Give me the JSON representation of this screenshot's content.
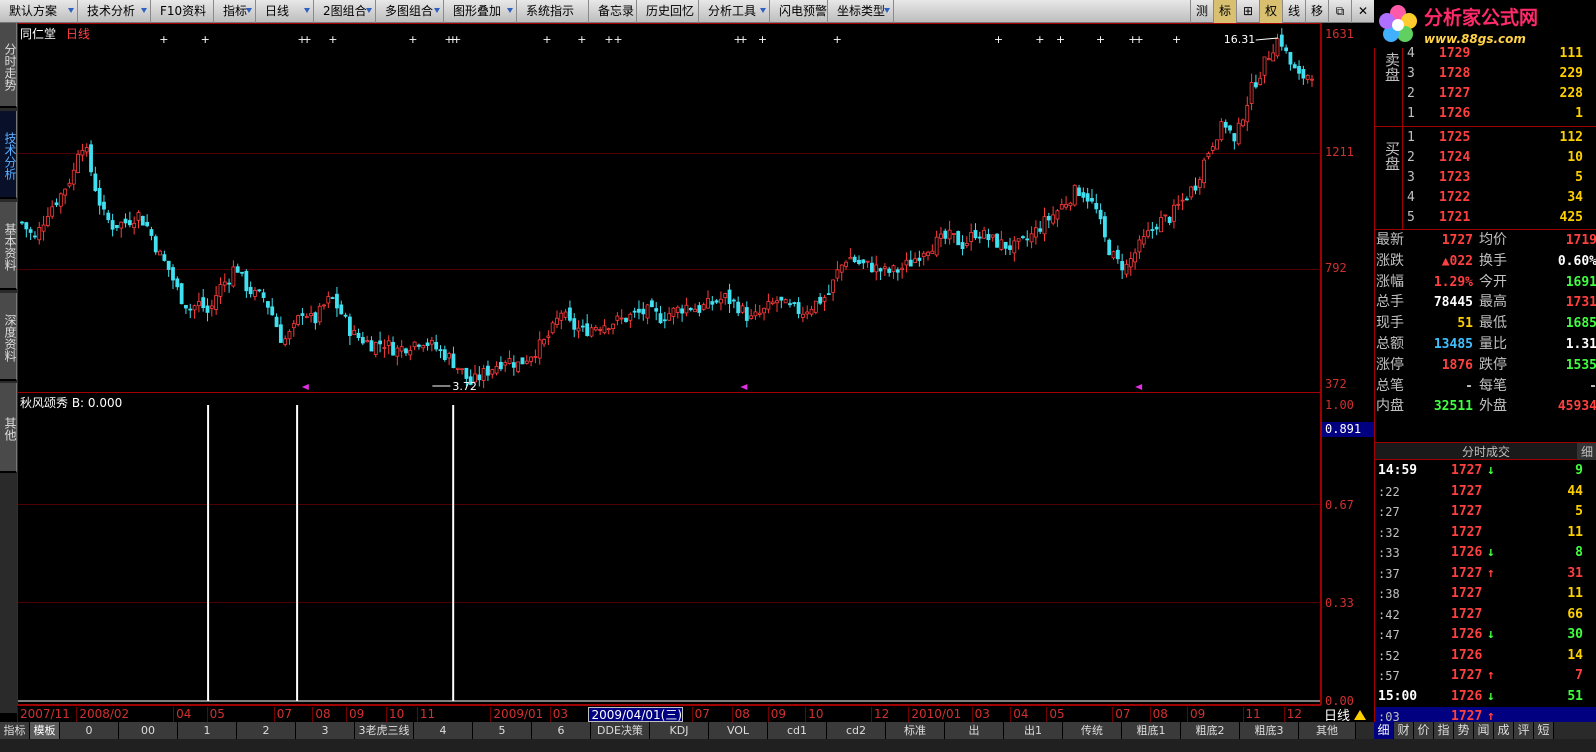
{
  "menu": [
    {
      "label": "默认方案",
      "arrow": true
    },
    {
      "label": "技术分析",
      "arrow": true
    },
    {
      "label": "F10资料",
      "arrow": false
    },
    {
      "label": "指标",
      "arrow": true
    },
    {
      "label": "日线",
      "arrow": true
    },
    {
      "label": "2图组合",
      "arrow": true
    },
    {
      "label": "多图组合",
      "arrow": true
    },
    {
      "label": "图形叠加",
      "arrow": true
    },
    {
      "label": "系统指示",
      "arrow": false
    },
    {
      "label": "备忘录",
      "arrow": false
    },
    {
      "label": "历史回忆",
      "arrow": false
    },
    {
      "label": "分析工具",
      "arrow": true
    },
    {
      "label": "闪电预警",
      "arrow": false
    },
    {
      "label": "坐标类型",
      "arrow": true
    }
  ],
  "toolbar_buttons": [
    "测",
    "标",
    "⊞",
    "权",
    "线",
    "移",
    "⧉",
    "✕"
  ],
  "logo": {
    "main": "分析家公式网",
    "url": "www.88gs.com"
  },
  "left_tabs": [
    "分时走势",
    "技术分析",
    "基本资料",
    "深度资料",
    "其他"
  ],
  "kchart": {
    "stock_name": "同仁堂",
    "period": "日线",
    "min_label": "3.72",
    "max_label": "16.31"
  },
  "indicator": {
    "title": "秋风颂秀 B: 0.000"
  },
  "price_axis": [
    "1631",
    "1211",
    "792",
    "372"
  ],
  "indicator_axis": [
    "1.00",
    "0.67",
    "0.33",
    "0.00"
  ],
  "indicator_current": "0.891",
  "dates": [
    {
      "label": "2007/11",
      "pos": 0.0
    },
    {
      "label": "2008/02",
      "pos": 0.046
    },
    {
      "label": "04",
      "pos": 0.121
    },
    {
      "label": "05",
      "pos": 0.147
    },
    {
      "label": "07",
      "pos": 0.199
    },
    {
      "label": "08",
      "pos": 0.229
    },
    {
      "label": "09",
      "pos": 0.255
    },
    {
      "label": "10",
      "pos": 0.286
    },
    {
      "label": "11",
      "pos": 0.31
    },
    {
      "label": "2009/01",
      "pos": 0.367
    },
    {
      "label": "03",
      "pos": 0.413
    },
    {
      "label": "2009/04/01(三)",
      "pos": 0.443,
      "current": true
    },
    {
      "label": "07",
      "pos": 0.523
    },
    {
      "label": "08",
      "pos": 0.554
    },
    {
      "label": "09",
      "pos": 0.582
    },
    {
      "label": "10",
      "pos": 0.611
    },
    {
      "label": "12",
      "pos": 0.662
    },
    {
      "label": "2010/01",
      "pos": 0.691
    },
    {
      "label": "03",
      "pos": 0.74
    },
    {
      "label": "04",
      "pos": 0.77
    },
    {
      "label": "05",
      "pos": 0.798
    },
    {
      "label": "07",
      "pos": 0.849
    },
    {
      "label": "08",
      "pos": 0.878
    },
    {
      "label": "09",
      "pos": 0.907
    },
    {
      "label": "11",
      "pos": 0.95
    },
    {
      "label": "12",
      "pos": 0.982
    }
  ],
  "period_label": "日线",
  "bottom_tabs": [
    {
      "label": "指标",
      "w": 30
    },
    {
      "label": "模板",
      "w": 30,
      "on": true
    },
    {
      "label": "0",
      "w": 59
    },
    {
      "label": "00",
      "w": 59
    },
    {
      "label": "1",
      "w": 59
    },
    {
      "label": "2",
      "w": 59
    },
    {
      "label": "3",
      "w": 59
    },
    {
      "label": "3老虎三线",
      "w": 59
    },
    {
      "label": "4",
      "w": 59
    },
    {
      "label": "5",
      "w": 59
    },
    {
      "label": "6",
      "w": 59
    },
    {
      "label": "DDE决策",
      "w": 59
    },
    {
      "label": "KDJ",
      "w": 59
    },
    {
      "label": "VOL",
      "w": 59
    },
    {
      "label": "cd1",
      "w": 59
    },
    {
      "label": "cd2",
      "w": 59
    },
    {
      "label": "标准",
      "w": 59
    },
    {
      "label": "出",
      "w": 59
    },
    {
      "label": "出1",
      "w": 59
    },
    {
      "label": "传统",
      "w": 59
    },
    {
      "label": "粗底1",
      "w": 59
    },
    {
      "label": "粗底2",
      "w": 59
    },
    {
      "label": "粗底3",
      "w": 59
    },
    {
      "label": "其他",
      "w": 57
    }
  ],
  "order_book": {
    "sell_side_label": "卖盘",
    "buy_side_label": "买盘",
    "sell": [
      {
        "level": "4",
        "price": "1729",
        "vol": "111"
      },
      {
        "level": "3",
        "price": "1728",
        "vol": "229"
      },
      {
        "level": "2",
        "price": "1727",
        "vol": "228"
      },
      {
        "level": "1",
        "price": "1726",
        "vol": "1"
      }
    ],
    "buy": [
      {
        "level": "1",
        "price": "1725",
        "vol": "112"
      },
      {
        "level": "2",
        "price": "1724",
        "vol": "10"
      },
      {
        "level": "3",
        "price": "1723",
        "vol": "5"
      },
      {
        "level": "4",
        "price": "1722",
        "vol": "34"
      },
      {
        "level": "5",
        "price": "1721",
        "vol": "425"
      }
    ]
  },
  "stats": [
    {
      "k1": "最新",
      "v1": "1727",
      "c1": "red",
      "k2": "均价",
      "v2": "1719",
      "c2": "red"
    },
    {
      "k1": "涨跌",
      "v1": "▲022",
      "c1": "red",
      "k2": "换手",
      "v2": "0.60%",
      "c2": "white"
    },
    {
      "k1": "涨幅",
      "v1": "1.29%",
      "c1": "red",
      "k2": "今开",
      "v2": "1691",
      "c2": "green"
    },
    {
      "k1": "总手",
      "v1": "78445",
      "c1": "white",
      "k2": "最高",
      "v2": "1731",
      "c2": "red"
    },
    {
      "k1": "现手",
      "v1": "51",
      "c1": "yellow",
      "k2": "最低",
      "v2": "1685",
      "c2": "green"
    },
    {
      "k1": "总额",
      "v1": "13485",
      "c1": "cyan",
      "k2": "量比",
      "v2": "1.31",
      "c2": "white"
    },
    {
      "k1": "涨停",
      "v1": "1876",
      "c1": "red",
      "k2": "跌停",
      "v2": "1535",
      "c2": "green"
    },
    {
      "k1": "总笔",
      "v1": "-",
      "c1": "gray",
      "k2": "每笔",
      "v2": "-",
      "c2": "gray"
    },
    {
      "k1": "内盘",
      "v1": "32511",
      "c1": "green",
      "k2": "外盘",
      "v2": "45934",
      "c2": "red"
    }
  ],
  "ticks_header": "分时成交",
  "ticks_detail": "细",
  "ticks": [
    {
      "time": "14:59",
      "price": "1727",
      "dir": "down",
      "vol": "9",
      "full": true
    },
    {
      "time": ":22",
      "price": "1727",
      "dir": "",
      "vol": "44"
    },
    {
      "time": ":27",
      "price": "1727",
      "dir": "",
      "vol": "5"
    },
    {
      "time": ":32",
      "price": "1727",
      "dir": "",
      "vol": "11"
    },
    {
      "time": ":33",
      "price": "1726",
      "dir": "down",
      "vol": "8"
    },
    {
      "time": ":37",
      "price": "1727",
      "dir": "up",
      "vol": "31"
    },
    {
      "time": ":38",
      "price": "1727",
      "dir": "",
      "vol": "11"
    },
    {
      "time": ":42",
      "price": "1727",
      "dir": "",
      "vol": "66"
    },
    {
      "time": ":47",
      "price": "1726",
      "dir": "down",
      "vol": "30"
    },
    {
      "time": ":52",
      "price": "1726",
      "dir": "",
      "vol": "14"
    },
    {
      "time": ":57",
      "price": "1727",
      "dir": "up",
      "vol": "7"
    },
    {
      "time": "15:00",
      "price": "1726",
      "dir": "down",
      "vol": "51",
      "full": true
    },
    {
      "time": ":03",
      "price": "1727",
      "dir": "up",
      "vol": "",
      "sel": true
    }
  ],
  "right_tabs": [
    "细",
    "财",
    "价",
    "指",
    "势",
    "闻",
    "成",
    "评",
    "短"
  ],
  "colors": {
    "up": "#ff4040",
    "down": "#40ff40",
    "grid": "#500000",
    "frame": "#a00000"
  },
  "chart_data": {
    "type": "candlestick",
    "stock": "同仁堂",
    "period": "日线",
    "x_range": [
      "2007/11",
      "2010/12"
    ],
    "y_ticks": [
      3.72,
      7.92,
      12.11,
      16.31
    ],
    "price_series": [
      [
        0.0,
        9.6
      ],
      [
        0.01,
        9.0
      ],
      [
        0.02,
        10.0
      ],
      [
        0.03,
        10.6
      ],
      [
        0.04,
        11.4
      ],
      [
        0.045,
        12.6
      ],
      [
        0.05,
        12.1
      ],
      [
        0.056,
        11.0
      ],
      [
        0.063,
        9.9
      ],
      [
        0.07,
        9.5
      ],
      [
        0.08,
        9.6
      ],
      [
        0.09,
        9.9
      ],
      [
        0.098,
        9.4
      ],
      [
        0.106,
        8.5
      ],
      [
        0.114,
        7.9
      ],
      [
        0.122,
        7.0
      ],
      [
        0.13,
        6.5
      ],
      [
        0.138,
        6.7
      ],
      [
        0.145,
        6.3
      ],
      [
        0.152,
        7.2
      ],
      [
        0.16,
        7.6
      ],
      [
        0.166,
        8.1
      ],
      [
        0.172,
        7.4
      ],
      [
        0.18,
        7.0
      ],
      [
        0.188,
        6.9
      ],
      [
        0.195,
        6.2
      ],
      [
        0.202,
        5.3
      ],
      [
        0.21,
        5.7
      ],
      [
        0.218,
        6.5
      ],
      [
        0.226,
        6.0
      ],
      [
        0.234,
        6.6
      ],
      [
        0.24,
        6.9
      ],
      [
        0.248,
        6.3
      ],
      [
        0.256,
        5.6
      ],
      [
        0.264,
        5.4
      ],
      [
        0.272,
        5.2
      ],
      [
        0.28,
        5.3
      ],
      [
        0.29,
        5.0
      ],
      [
        0.3,
        5.2
      ],
      [
        0.31,
        5.4
      ],
      [
        0.32,
        5.1
      ],
      [
        0.33,
        4.8
      ],
      [
        0.34,
        4.3
      ],
      [
        0.348,
        3.8
      ],
      [
        0.356,
        4.1
      ],
      [
        0.365,
        4.4
      ],
      [
        0.375,
        4.7
      ],
      [
        0.385,
        4.5
      ],
      [
        0.395,
        4.9
      ],
      [
        0.405,
        5.3
      ],
      [
        0.412,
        5.8
      ],
      [
        0.418,
        6.4
      ],
      [
        0.425,
        5.9
      ],
      [
        0.435,
        5.7
      ],
      [
        0.445,
        5.9
      ],
      [
        0.455,
        6.0
      ],
      [
        0.465,
        6.1
      ],
      [
        0.475,
        6.3
      ],
      [
        0.485,
        6.4
      ],
      [
        0.495,
        6.2
      ],
      [
        0.505,
        6.4
      ],
      [
        0.515,
        6.6
      ],
      [
        0.525,
        6.5
      ],
      [
        0.535,
        6.7
      ],
      [
        0.545,
        6.9
      ],
      [
        0.555,
        6.6
      ],
      [
        0.565,
        6.1
      ],
      [
        0.575,
        6.4
      ],
      [
        0.585,
        6.8
      ],
      [
        0.595,
        6.5
      ],
      [
        0.605,
        6.4
      ],
      [
        0.615,
        6.7
      ],
      [
        0.625,
        7.0
      ],
      [
        0.632,
        7.8
      ],
      [
        0.64,
        8.4
      ],
      [
        0.65,
        8.1
      ],
      [
        0.66,
        8.0
      ],
      [
        0.67,
        7.8
      ],
      [
        0.68,
        7.9
      ],
      [
        0.69,
        8.2
      ],
      [
        0.7,
        8.7
      ],
      [
        0.71,
        8.9
      ],
      [
        0.72,
        9.1
      ],
      [
        0.73,
        8.8
      ],
      [
        0.74,
        9.3
      ],
      [
        0.75,
        9.0
      ],
      [
        0.76,
        8.8
      ],
      [
        0.77,
        8.7
      ],
      [
        0.78,
        9.0
      ],
      [
        0.79,
        9.5
      ],
      [
        0.8,
        9.9
      ],
      [
        0.81,
        10.4
      ],
      [
        0.818,
        10.8
      ],
      [
        0.825,
        10.6
      ],
      [
        0.833,
        10.0
      ],
      [
        0.84,
        8.9
      ],
      [
        0.848,
        8.2
      ],
      [
        0.856,
        8.0
      ],
      [
        0.864,
        8.6
      ],
      [
        0.872,
        9.1
      ],
      [
        0.88,
        9.6
      ],
      [
        0.89,
        9.8
      ],
      [
        0.9,
        10.4
      ],
      [
        0.91,
        11.0
      ],
      [
        0.918,
        12.0
      ],
      [
        0.926,
        12.8
      ],
      [
        0.934,
        13.2
      ],
      [
        0.94,
        12.4
      ],
      [
        0.947,
        13.6
      ],
      [
        0.954,
        14.5
      ],
      [
        0.961,
        15.1
      ],
      [
        0.968,
        15.8
      ],
      [
        0.975,
        16.3
      ],
      [
        0.982,
        15.4
      ],
      [
        0.99,
        14.8
      ],
      [
        1.0,
        15.0
      ]
    ],
    "indicator_series": {
      "name": "秋风颂秀 B",
      "range": [
        0,
        1
      ],
      "signals_at": [
        0.121,
        0.19,
        0.311
      ]
    }
  }
}
